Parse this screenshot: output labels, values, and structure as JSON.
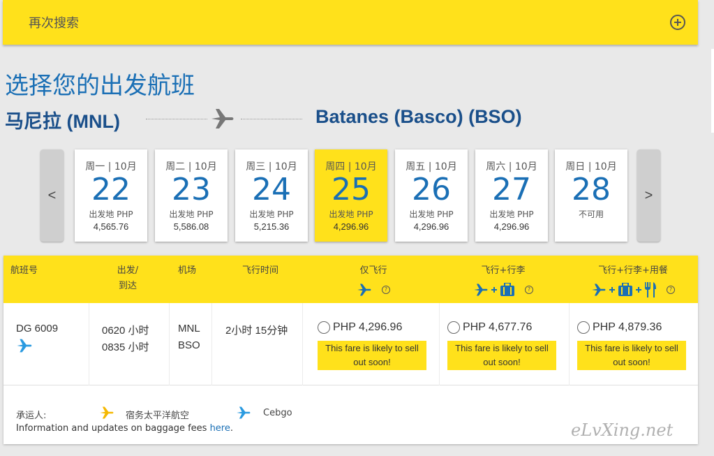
{
  "search_again": {
    "label": "再次搜索"
  },
  "page_title": "选择您的出发航班",
  "route": {
    "origin": "马尼拉 (MNL)",
    "destination": "Batanes (Basco) (BSO)"
  },
  "date_nav": {
    "prev": "<",
    "next": ">"
  },
  "days": [
    {
      "dow": "周一 | 10月",
      "day": "22",
      "label": "出发地 PHP",
      "price": "4,565.76"
    },
    {
      "dow": "周二 | 10月",
      "day": "23",
      "label": "出发地 PHP",
      "price": "5,586.08"
    },
    {
      "dow": "周三 | 10月",
      "day": "24",
      "label": "出发地 PHP",
      "price": "5,215.36"
    },
    {
      "dow": "周四 | 10月",
      "day": "25",
      "label": "出发地 PHP",
      "price": "4,296.96",
      "selected": true
    },
    {
      "dow": "周五 | 10月",
      "day": "26",
      "label": "出发地 PHP",
      "price": "4,296.96"
    },
    {
      "dow": "周六 | 10月",
      "day": "27",
      "label": "出发地 PHP",
      "price": "4,296.96"
    },
    {
      "dow": "周日 | 10月",
      "day": "28",
      "label": "不可用",
      "price": ""
    }
  ],
  "table": {
    "headers": {
      "flight_no": "航班号",
      "depart": "出发/",
      "arrive": "到达",
      "airport": "机场",
      "duration": "飞行时间",
      "fly_only": "仅飞行",
      "fly_bag": "飞行+行李",
      "fly_bag_meal": "飞行+行李+用餐"
    },
    "rows": [
      {
        "flight_no": "DG 6009",
        "depart_time": "0620 小时",
        "arrive_time": "0835 小时",
        "origin_code": "MNL",
        "dest_code": "BSO",
        "duration": "2小时 15分钟",
        "fares": [
          {
            "price": "PHP 4,296.96",
            "note_1": "This fare is likely to sell",
            "note_2": "out soon!"
          },
          {
            "price": "PHP 4,677.76",
            "note_1": "This fare is likely to sell",
            "note_2": "out soon!"
          },
          {
            "price": "PHP 4,879.36",
            "note_1": "This fare is likely to sell",
            "note_2": "out soon!"
          }
        ]
      }
    ],
    "help_glyph": "?"
  },
  "footer": {
    "carrier_label": "承运人:",
    "carrier_1": "宿务太平洋航空",
    "carrier_2": "Cebgo",
    "info_text": "Information and updates on baggage fees ",
    "info_link": "here",
    "info_end": "."
  },
  "watermark": "eLvXing.net",
  "colors": {
    "accent_yellow": "#ffe11b",
    "brand_blue": "#1a6fb5",
    "plane_yellow": "#f5b800",
    "plane_blue": "#2a9ae0"
  }
}
